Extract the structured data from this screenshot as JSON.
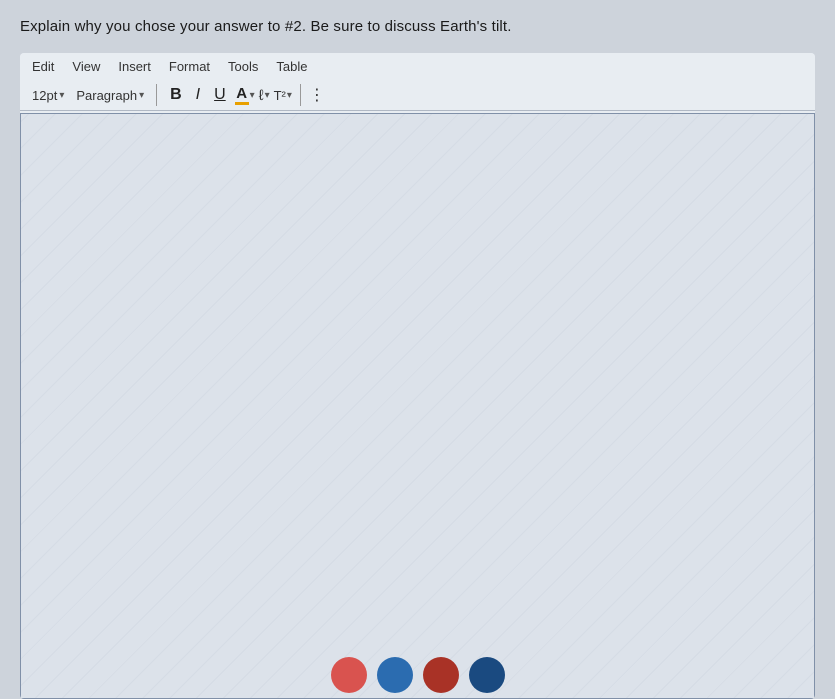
{
  "question": {
    "text": "Explain why you chose your answer to #2. Be sure to discuss Earth's tilt."
  },
  "menu": {
    "items": [
      "Edit",
      "View",
      "Insert",
      "Format",
      "Tools",
      "Table"
    ]
  },
  "toolbar": {
    "font_size": "12pt",
    "font_size_chevron": "▾",
    "paragraph": "Paragraph",
    "paragraph_chevron": "▾",
    "bold": "B",
    "italic": "I",
    "underline": "U",
    "font_color": "A",
    "chevron": "▾",
    "eraser": "ℓ",
    "superscript": "T²",
    "more": "⋮"
  },
  "editor": {
    "placeholder": ""
  },
  "bottom_buttons": [
    {
      "color": "red",
      "label": "red-button"
    },
    {
      "color": "blue",
      "label": "blue-button"
    },
    {
      "color": "dark-red",
      "label": "dark-red-button"
    },
    {
      "color": "dark-blue",
      "label": "dark-blue-button"
    }
  ]
}
